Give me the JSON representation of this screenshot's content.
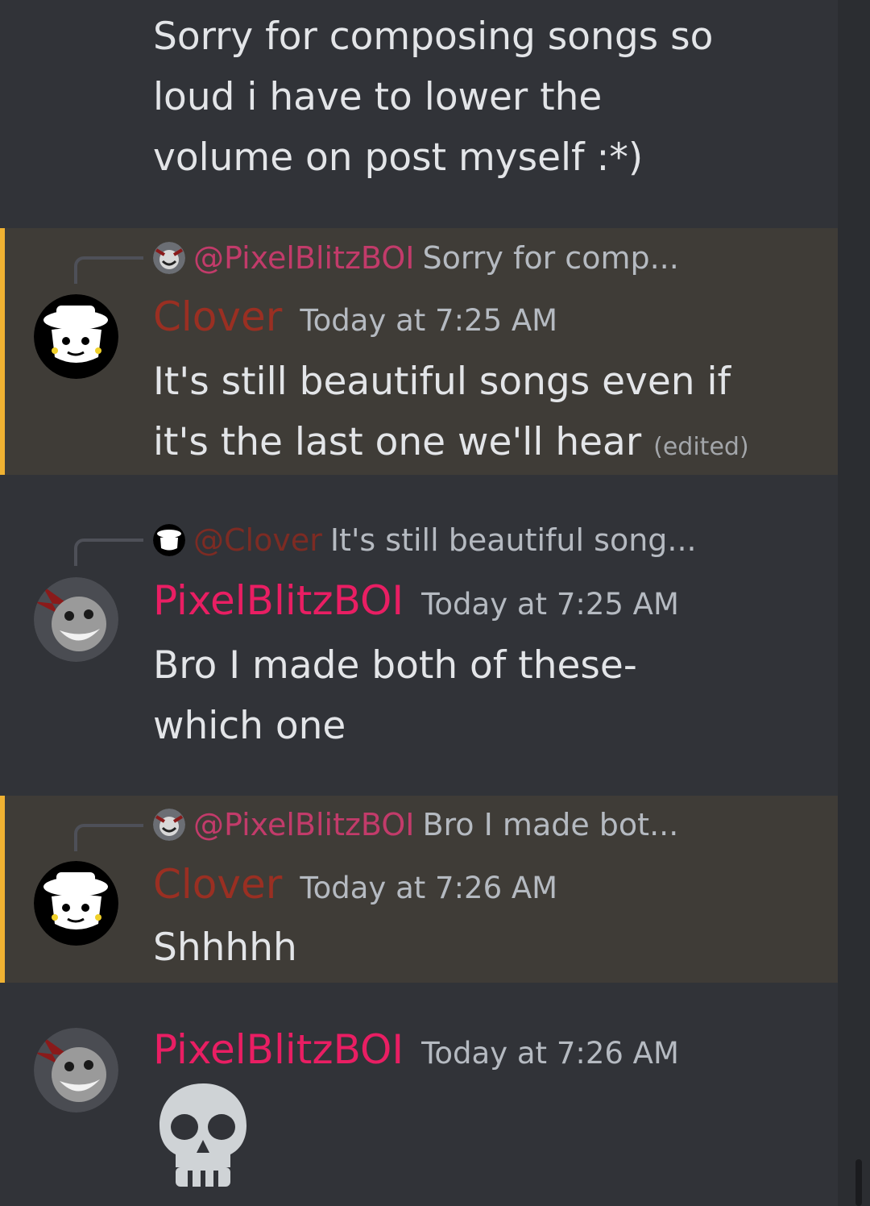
{
  "messages": [
    {
      "text_lines": [
        "Sorry for composing songs so",
        "loud i have to lower the",
        "volume on post myself :*)"
      ]
    },
    {
      "author": "Clover",
      "timestamp": "Today at 7:25 AM",
      "highlighted": true,
      "reply": {
        "mention": "@PixelBlitzBOI",
        "preview": "Sorry for comp..."
      },
      "text_lines": [
        "It's still beautiful songs even if",
        "it's the last one we'll hear"
      ],
      "edited": "(edited)"
    },
    {
      "author": "PixelBlitzBOI",
      "timestamp": "Today at 7:25 AM",
      "reply": {
        "mention": "@Clover",
        "preview": "It's still beautiful song..."
      },
      "text_lines": [
        "Bro I made both of these-",
        "which one"
      ]
    },
    {
      "author": "Clover",
      "timestamp": "Today at 7:26 AM",
      "highlighted": true,
      "reply": {
        "mention": "@PixelBlitzBOI",
        "preview": "Bro I made bot..."
      },
      "text_lines": [
        "Shhhhh"
      ]
    },
    {
      "author": "PixelBlitzBOI",
      "timestamp": "Today at 7:26 AM",
      "emoji": "skull-emoji"
    }
  ],
  "colors": {
    "background": "#313338",
    "highlight_bg": "#3f3c37",
    "highlight_bar": "#f0b232",
    "clover_name": "#9a2f22",
    "pixel_name": "#e91e63"
  }
}
